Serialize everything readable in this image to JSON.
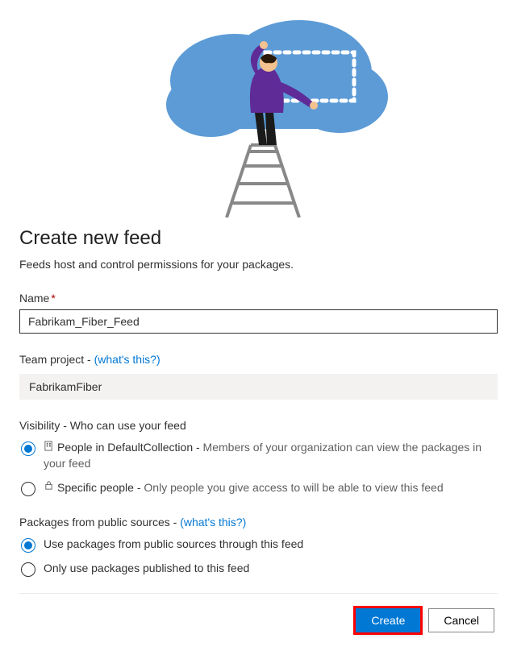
{
  "illustration": {
    "alt": "Person on ladder drawing dotted selection on cloud"
  },
  "title": "Create new feed",
  "subtitle": "Feeds host and control permissions for your packages.",
  "name_field": {
    "label": "Name",
    "required_marker": "*",
    "value": "Fabrikam_Fiber_Feed"
  },
  "team_project": {
    "label": "Team project -",
    "help_link": "(what's this?)",
    "value": "FabrikamFiber"
  },
  "visibility": {
    "label": "Visibility - Who can use your feed",
    "options": [
      {
        "title_prefix": "People in DefaultCollection - ",
        "description": "Members of your organization can view the packages in your feed",
        "selected": true,
        "icon": "org"
      },
      {
        "title_prefix": "Specific people - ",
        "description": "Only people you give access to will be able to view this feed",
        "selected": false,
        "icon": "lock"
      }
    ]
  },
  "packages": {
    "label": "Packages from public sources -",
    "help_link": "(what's this?)",
    "options": [
      {
        "label": "Use packages from public sources through this feed",
        "selected": true
      },
      {
        "label": "Only use packages published to this feed",
        "selected": false
      }
    ]
  },
  "buttons": {
    "create_label": "Create",
    "cancel_label": "Cancel"
  }
}
